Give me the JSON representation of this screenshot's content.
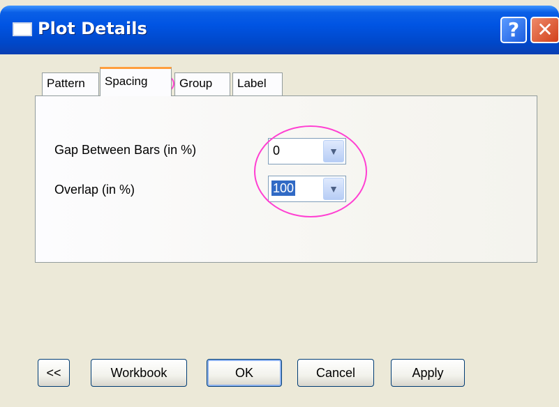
{
  "window": {
    "title": "Plot Details",
    "help_label": "?",
    "close_label": "✕"
  },
  "tabs": [
    {
      "label": "Pattern"
    },
    {
      "label": "Spacing",
      "active": true
    },
    {
      "label": "Group"
    },
    {
      "label": "Label"
    }
  ],
  "fields": {
    "gap_label": "Gap Between Bars (in %)",
    "gap_value": "0",
    "overlap_label": "Overlap (in %)",
    "overlap_value": "100"
  },
  "buttons": {
    "back": "<<",
    "workbook": "Workbook",
    "ok": "OK",
    "cancel": "Cancel",
    "apply": "Apply"
  },
  "icons": {
    "dropdown": "chevron-down-icon",
    "window": "window-icon",
    "help": "help-icon",
    "close": "close-icon"
  },
  "colors": {
    "titlebar": "#0054e3",
    "annotation": "#ff3fd2",
    "active_tab_accent": "#ff9e3d",
    "selection": "#316ac5"
  }
}
